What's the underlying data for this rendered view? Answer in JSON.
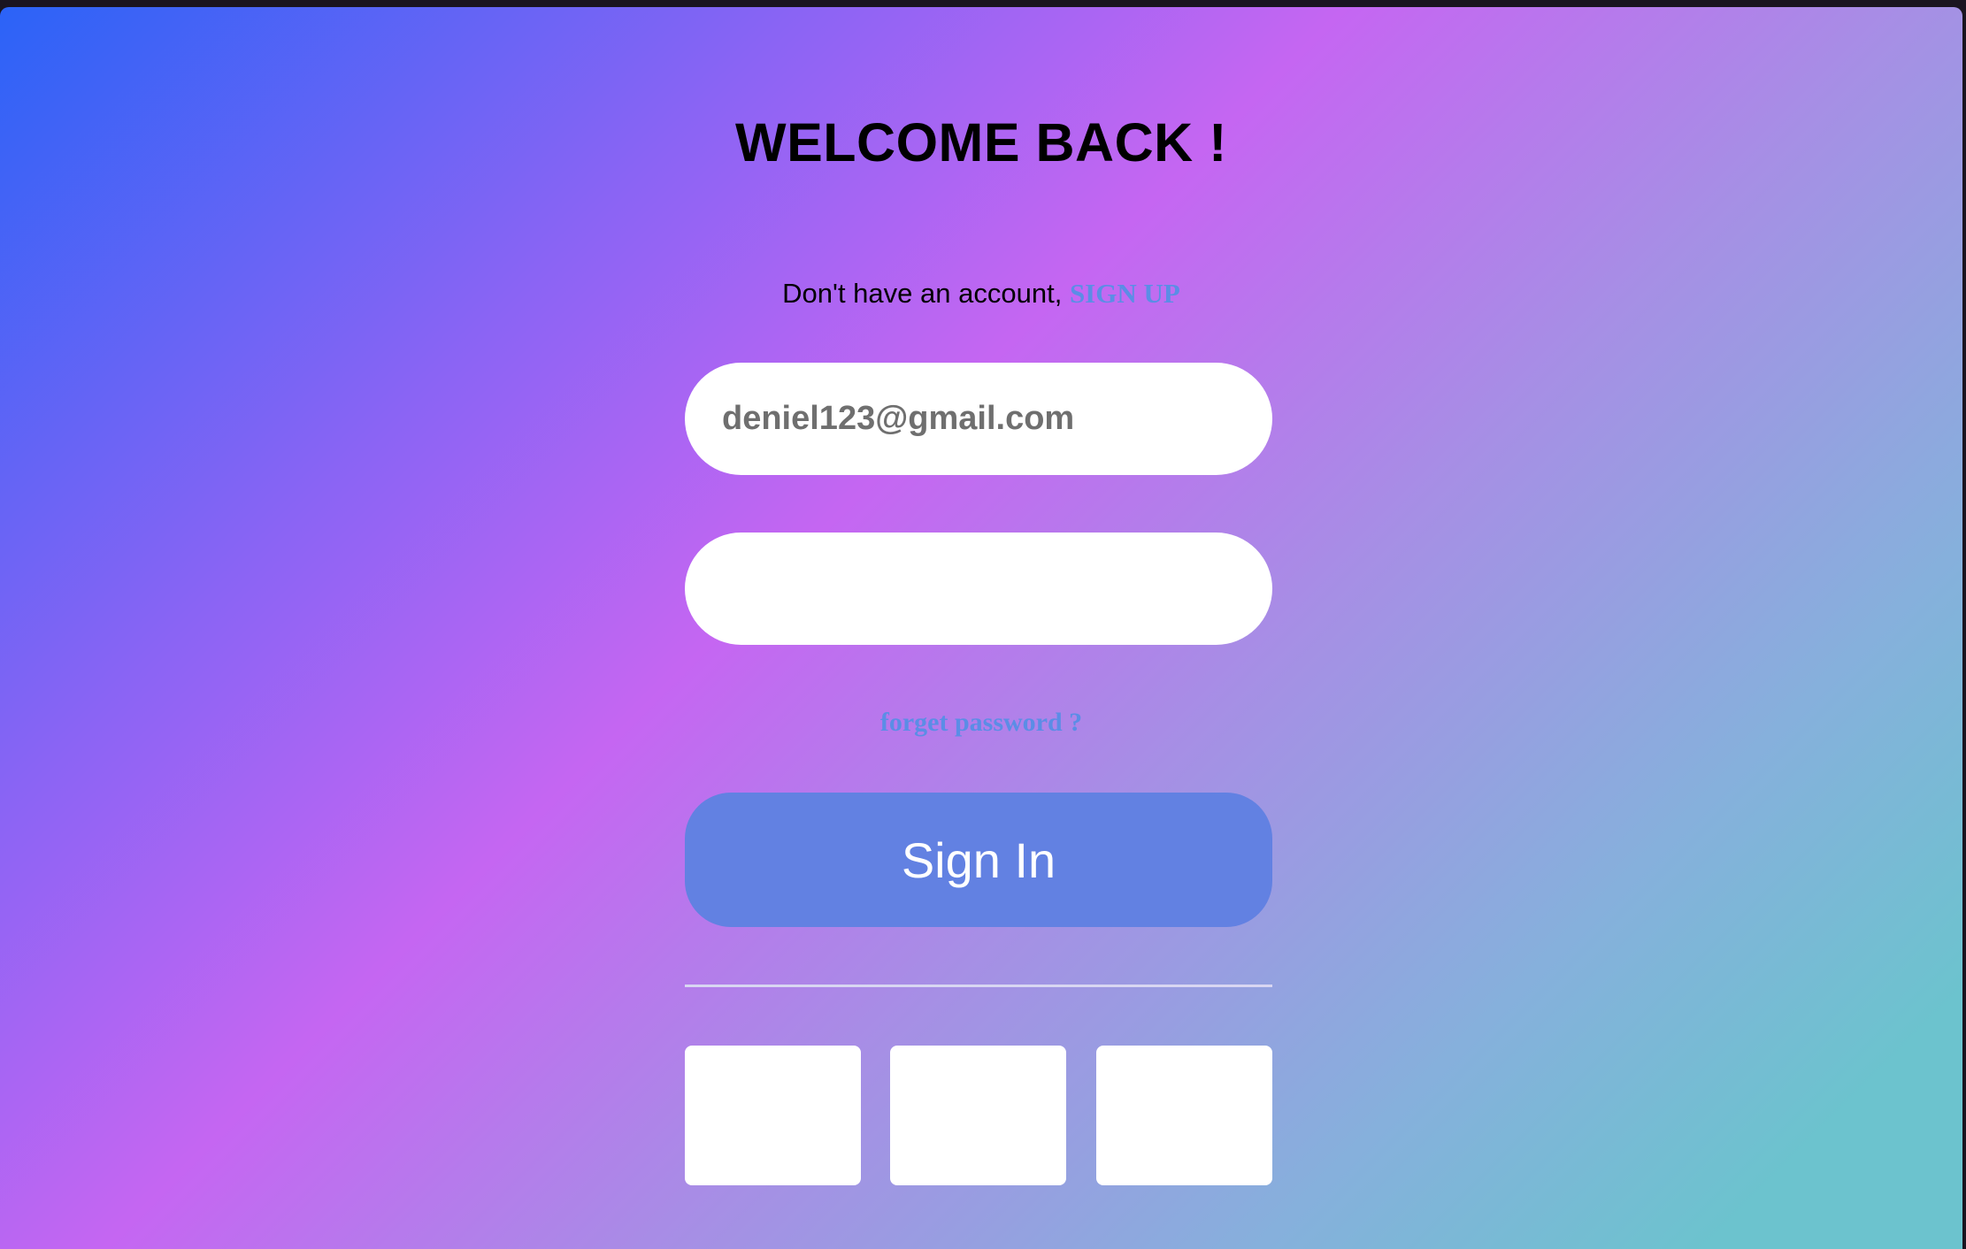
{
  "login": {
    "title": "WELCOME BACK !",
    "signup_prompt": "Don't have an account,",
    "signup_link": "SIGN UP",
    "email_value": "deniel123@gmail.com",
    "password_value": "",
    "forgot_link": "forget password ?",
    "signin_label": "Sign In",
    "social_buttons": [
      "",
      "",
      ""
    ]
  },
  "colors": {
    "link": "#5b8de6",
    "button": "#6281e2",
    "gradient": [
      "#2b63f7",
      "#c566f2",
      "#6cc3ce"
    ]
  }
}
